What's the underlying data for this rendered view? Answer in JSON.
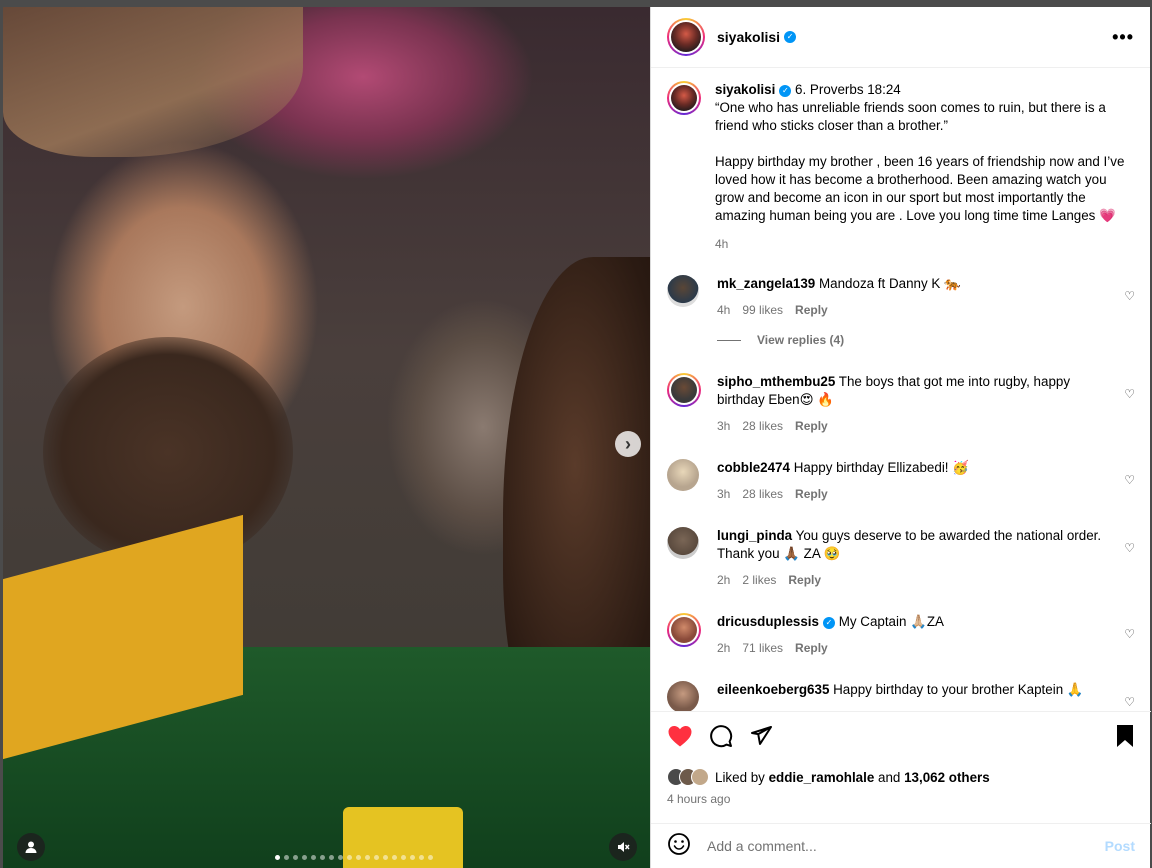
{
  "post": {
    "username": "siyakolisi",
    "verified_icon": "verified-badge-icon",
    "caption_lines": [
      "6. Proverbs 18:24",
      "“One who has unreliable friends soon comes to ruin, but there is a friend who sticks closer than a brother.”",
      "Happy birthday my brother , been 16 years of friendship now and I’ve loved how it has become a brotherhood. Been amazing watch you grow and become an icon in our sport but most importantly the amazing human being you are . Love you long time time Langes 💗"
    ],
    "caption_time": "4h"
  },
  "comments": [
    {
      "user": "mk_zangela139",
      "text": "Mandoza ft Danny K 🐅",
      "time": "4h",
      "likes": "99 likes",
      "reply": "Reply",
      "ring": false,
      "avatar_color": "#2b3a4a"
    },
    {
      "user": "sipho_mthembu25",
      "text": "The boys that got me into rugby, happy birthday Eben😍 🔥",
      "time": "3h",
      "likes": "28 likes",
      "reply": "Reply",
      "ring": true,
      "avatar_color": "#3a3a3a"
    },
    {
      "user": "cobble2474",
      "text": "Happy birthday Ellizabedi! 🥳",
      "time": "3h",
      "likes": "28 likes",
      "reply": "Reply",
      "ring": false,
      "avatar_color": "#b7a58f"
    },
    {
      "user": "lungi_pinda",
      "text": "You guys deserve to be awarded the national order. Thank you 🙏🏾 ZA 🥹",
      "time": "2h",
      "likes": "2 likes",
      "reply": "Reply",
      "ring": false,
      "avatar_color": "#5a4a3e"
    },
    {
      "user": "dricusduplessis",
      "text": "My Captain 🙏🏼ZA",
      "time": "2h",
      "likes": "71 likes",
      "reply": "Reply",
      "ring": true,
      "verified": true,
      "avatar_color": "#8a4a3a"
    },
    {
      "user": "eileenkoeberg635",
      "text": "Happy birthday to your brother Kaptein 🙏",
      "time": "",
      "likes": "",
      "reply": "",
      "ring": false,
      "avatar_color": "#7a5a4a"
    }
  ],
  "view_replies": "View replies (4)",
  "likes_text": {
    "prefix": "Liked by",
    "user": "eddie_ramohlale",
    "middle": "and",
    "count": "13,062 others"
  },
  "posted_time": "4 hours ago",
  "add_comment": {
    "placeholder": "Add a comment...",
    "post_label": "Post"
  },
  "media": {
    "next_icon": "chevron-right-icon",
    "mute_icon": "muted-speaker-icon",
    "user_tag_icon": "person-icon"
  },
  "colors": {
    "like_red": "#ff3040",
    "link_blue": "#0095f6",
    "post_disabled": "#b3dbff"
  }
}
